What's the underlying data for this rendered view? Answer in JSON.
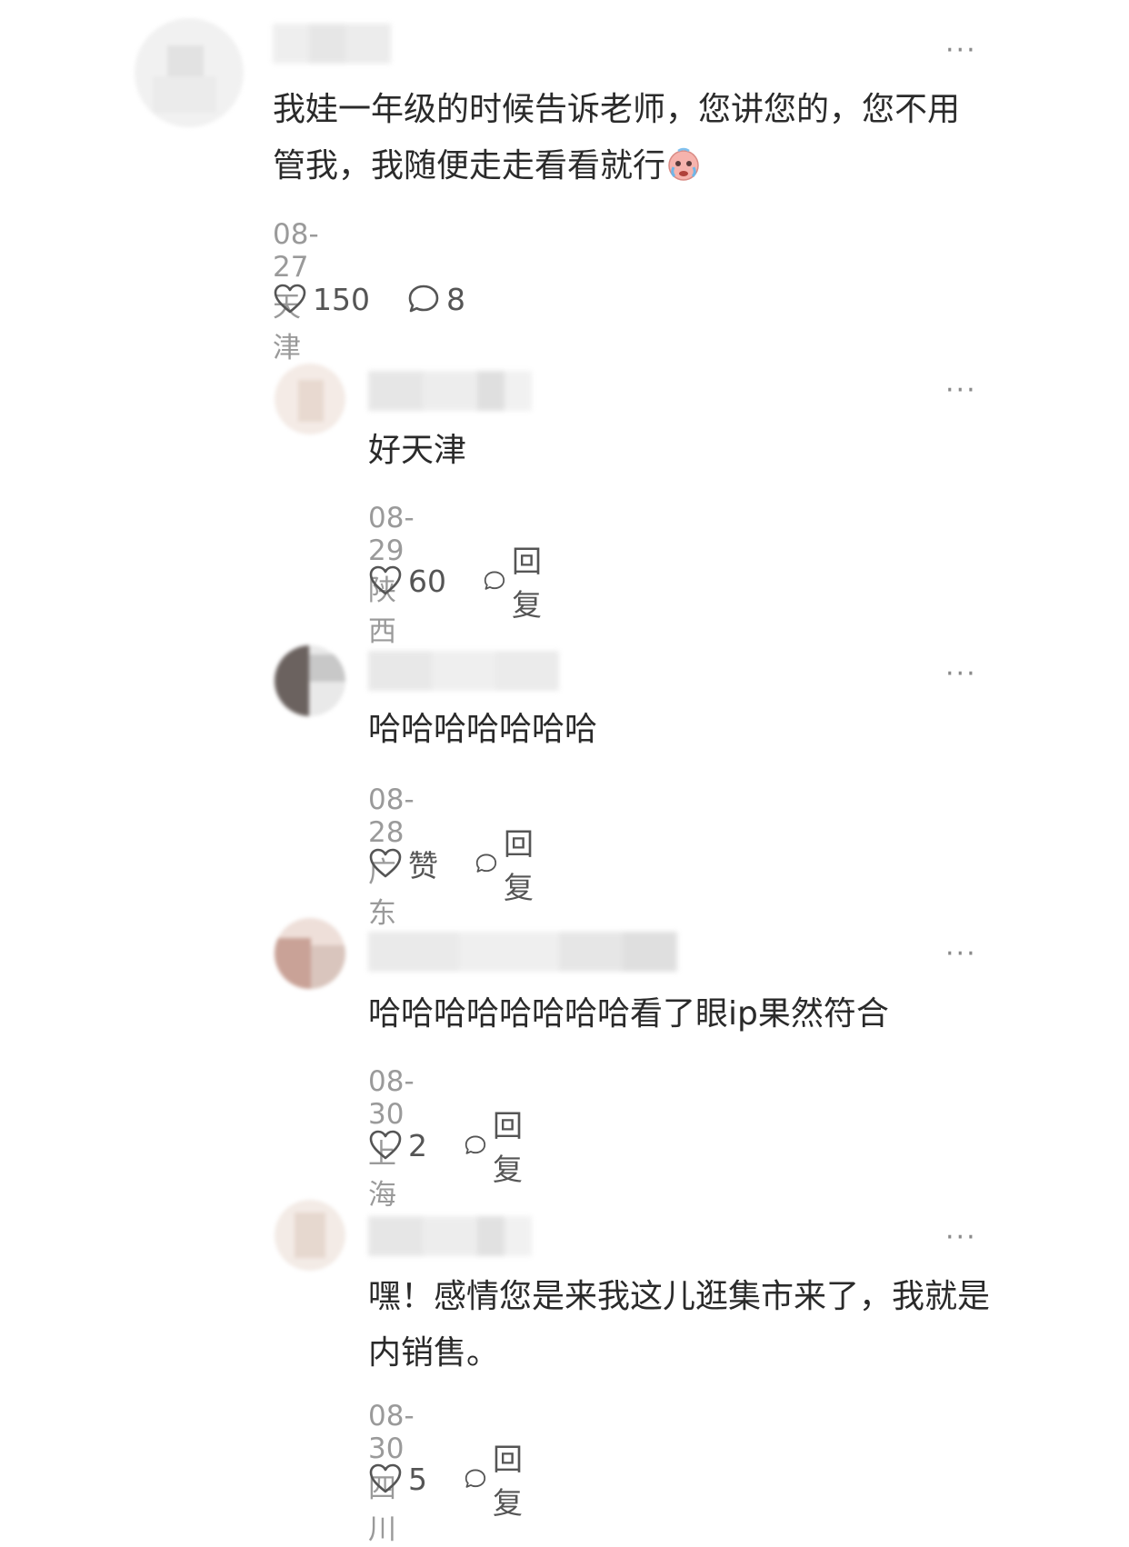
{
  "comments": [
    {
      "text": "我娃一年级的时候告诉老师，您讲您的，您不用管我，我随便走走看看就行",
      "emoji": "crying-face-emoji",
      "date": "08-27",
      "location": "天津",
      "likes": "150",
      "replies": "8"
    },
    {
      "text": "好天津",
      "date": "08-29",
      "location": "陕西",
      "likes": "60",
      "reply_label": "回复"
    },
    {
      "text": "哈哈哈哈哈哈哈",
      "date": "08-28",
      "location": "广东",
      "likes": "赞",
      "reply_label": "回复"
    },
    {
      "text": "哈哈哈哈哈哈哈哈看了眼ip果然符合",
      "date": "08-30",
      "location": "上海",
      "likes": "2",
      "reply_label": "回复"
    },
    {
      "text": "嘿！感情您是来我这儿逛集市来了，我就是内销售。",
      "date": "08-30",
      "location": "四川",
      "likes": "5",
      "reply_label": "回复"
    }
  ],
  "icons": {
    "like": "heart-outline-icon",
    "comment": "speech-bubble-icon",
    "more": "more-dots-icon"
  },
  "colors": {
    "text": "#2a2a2a",
    "meta": "#9a9a9a",
    "icon": "#555555"
  }
}
